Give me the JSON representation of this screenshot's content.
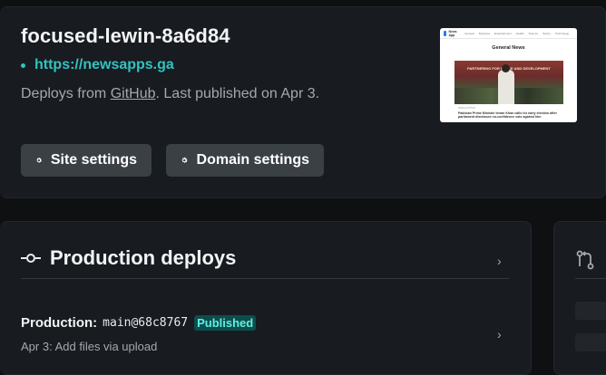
{
  "site": {
    "name": "focused-lewin-8a6d84",
    "url": "https://newsapps.ga",
    "deploy_prefix": "Deploys from ",
    "deploy_source": "GitHub",
    "deploy_suffix": ". Last published on Apr 3.",
    "buttons": {
      "site_settings": "Site settings",
      "domain_settings": "Domain settings"
    },
    "thumbnail": {
      "logo_text": "News App",
      "nav_items": [
        "General",
        "Business",
        "Entertainment",
        "Health",
        "Science",
        "Sports",
        "Technology"
      ],
      "heading": "General News",
      "image_banner": "PARTNERING FOR PEACE AND DEVELOPMENT",
      "caption_meta": "NEWS.AUTHOR",
      "caption": "Pakistan Prime Minister Imran Khan calls for early election after parliament dismisses no-confidence vote against him"
    }
  },
  "production": {
    "title": "Production deploys",
    "row": {
      "label": "Production",
      "colon": ":",
      "ref": "main@68c8767",
      "badge": "Published",
      "message": "Apr 3: Add files via upload"
    }
  },
  "icons": {
    "settings": "gear-icon",
    "deploys": "commit-icon",
    "chevron": "chevron-right-icon",
    "branches": "git-compare-icon"
  },
  "colors": {
    "background": "#0e1012",
    "card": "#181b20",
    "accent_teal": "#32c3c0",
    "badge_bg": "#0d4e4c",
    "badge_text": "#5ff0e4",
    "button": "#3b4045"
  }
}
